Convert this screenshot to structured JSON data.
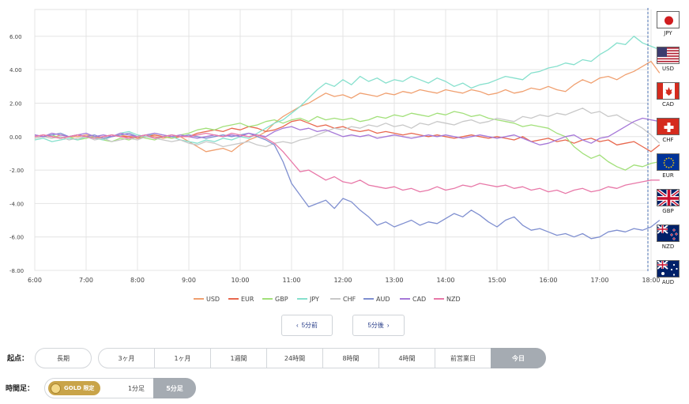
{
  "chart_data": {
    "type": "line",
    "x": [
      "6:00",
      "6:10",
      "6:20",
      "6:30",
      "6:40",
      "6:50",
      "7:00",
      "7:10",
      "7:20",
      "7:30",
      "7:40",
      "7:50",
      "8:00",
      "8:10",
      "8:20",
      "8:30",
      "8:40",
      "8:50",
      "9:00",
      "9:10",
      "9:20",
      "9:30",
      "9:40",
      "9:50",
      "10:00",
      "10:10",
      "10:20",
      "10:30",
      "10:40",
      "10:50",
      "11:00",
      "11:10",
      "11:20",
      "11:30",
      "11:40",
      "11:50",
      "12:00",
      "12:10",
      "12:20",
      "12:30",
      "12:40",
      "12:50",
      "13:00",
      "13:10",
      "13:20",
      "13:30",
      "13:40",
      "13:50",
      "14:00",
      "14:10",
      "14:20",
      "14:30",
      "14:40",
      "14:50",
      "15:00",
      "15:10",
      "15:20",
      "15:30",
      "15:40",
      "15:50",
      "16:00",
      "16:10",
      "16:20",
      "16:30",
      "16:40",
      "16:50",
      "17:00",
      "17:10",
      "17:20",
      "17:30",
      "17:40",
      "17:50",
      "18:00",
      "18:10"
    ],
    "xticks": [
      "6:00",
      "7:00",
      "8:00",
      "9:00",
      "10:00",
      "11:00",
      "12:00",
      "13:00",
      "14:00",
      "15:00",
      "16:00",
      "17:00",
      "18:00"
    ],
    "yticks": [
      "6.00",
      "4.00",
      "2.00",
      "0.00",
      "-2.00",
      "-4.00",
      "-6.00",
      "-8.00"
    ],
    "ylim": [
      -8,
      7.6
    ],
    "series": [
      {
        "name": "USD",
        "color": "#f0a070",
        "values": [
          0.1,
          0.0,
          -0.1,
          0.1,
          0.0,
          0.0,
          0.1,
          0.0,
          -0.1,
          0.0,
          0.1,
          0.0,
          0.0,
          0.1,
          0.0,
          -0.1,
          0.0,
          0.0,
          -0.3,
          -0.6,
          -0.9,
          -0.8,
          -0.7,
          -0.9,
          -0.5,
          -0.2,
          0.0,
          0.3,
          0.8,
          1.2,
          1.5,
          1.8,
          2.0,
          2.3,
          2.6,
          2.4,
          2.5,
          2.3,
          2.6,
          2.5,
          2.4,
          2.6,
          2.5,
          2.7,
          2.6,
          2.8,
          2.7,
          2.6,
          2.8,
          2.7,
          2.6,
          2.8,
          2.7,
          2.5,
          2.6,
          2.8,
          2.6,
          2.7,
          2.9,
          2.8,
          3.0,
          2.8,
          2.7,
          3.1,
          3.4,
          3.2,
          3.5,
          3.6,
          3.4,
          3.7,
          3.9,
          4.2,
          4.5,
          3.8
        ]
      },
      {
        "name": "EUR",
        "color": "#e8684e",
        "values": [
          0.0,
          0.1,
          0.0,
          -0.1,
          0.0,
          0.1,
          0.0,
          -0.1,
          0.0,
          0.1,
          0.0,
          0.0,
          -0.1,
          0.0,
          0.1,
          0.0,
          -0.1,
          0.0,
          0.0,
          0.2,
          0.3,
          0.4,
          0.3,
          0.5,
          0.4,
          0.6,
          0.5,
          0.3,
          0.4,
          0.6,
          0.9,
          1.0,
          0.8,
          0.6,
          0.7,
          0.5,
          0.6,
          0.4,
          0.3,
          0.4,
          0.2,
          0.3,
          0.2,
          0.1,
          0.2,
          0.1,
          0.0,
          0.1,
          0.0,
          -0.1,
          0.0,
          0.1,
          0.0,
          -0.1,
          0.0,
          -0.1,
          -0.2,
          0.0,
          -0.3,
          -0.2,
          -0.1,
          -0.3,
          -0.2,
          -0.4,
          -0.2,
          -0.1,
          -0.3,
          -0.2,
          -0.5,
          -0.4,
          -0.3,
          -0.6,
          -0.9,
          -0.5
        ]
      },
      {
        "name": "GBP",
        "color": "#a2e07a",
        "values": [
          -0.1,
          0.0,
          0.1,
          -0.1,
          0.0,
          -0.2,
          -0.1,
          0.0,
          -0.2,
          -0.3,
          -0.1,
          -0.2,
          0.0,
          -0.1,
          -0.2,
          0.0,
          -0.1,
          0.1,
          0.2,
          0.4,
          0.5,
          0.4,
          0.6,
          0.7,
          0.8,
          0.6,
          0.7,
          0.9,
          1.0,
          0.8,
          1.0,
          1.1,
          0.9,
          1.2,
          1.0,
          1.1,
          1.0,
          1.1,
          0.9,
          1.0,
          1.2,
          1.1,
          1.3,
          1.2,
          1.4,
          1.3,
          1.2,
          1.4,
          1.3,
          1.5,
          1.4,
          1.2,
          1.3,
          1.1,
          1.0,
          0.9,
          0.8,
          0.6,
          0.7,
          0.6,
          0.5,
          0.2,
          0.0,
          -0.6,
          -1.0,
          -1.3,
          -1.1,
          -1.5,
          -1.8,
          -2.0,
          -1.7,
          -1.8,
          -1.6,
          -1.5
        ]
      },
      {
        "name": "JPY",
        "color": "#86e0cd",
        "values": [
          -0.2,
          -0.1,
          -0.3,
          -0.2,
          -0.1,
          -0.2,
          0.0,
          -0.1,
          -0.2,
          0.0,
          0.2,
          0.3,
          0.1,
          0.0,
          0.2,
          0.1,
          0.0,
          -0.2,
          -0.3,
          -0.4,
          -0.2,
          -0.3,
          -0.1,
          -0.2,
          0.0,
          -0.1,
          0.2,
          0.5,
          0.8,
          1.0,
          1.4,
          1.8,
          2.3,
          2.8,
          3.2,
          3.0,
          3.4,
          3.1,
          3.6,
          3.3,
          3.5,
          3.2,
          3.4,
          3.3,
          3.6,
          3.4,
          3.2,
          3.5,
          3.3,
          3.0,
          3.2,
          2.9,
          3.1,
          3.2,
          3.4,
          3.6,
          3.5,
          3.4,
          3.8,
          3.9,
          4.1,
          4.2,
          4.4,
          4.3,
          4.6,
          4.5,
          4.9,
          5.2,
          5.6,
          5.5,
          6.0,
          5.6,
          5.4,
          5.2
        ]
      },
      {
        "name": "CHF",
        "color": "#c8c8c8",
        "values": [
          -0.1,
          0.0,
          -0.1,
          0.0,
          -0.2,
          -0.1,
          0.0,
          -0.2,
          -0.1,
          -0.3,
          -0.2,
          -0.1,
          -0.2,
          0.0,
          -0.1,
          -0.2,
          -0.3,
          -0.2,
          -0.4,
          -0.5,
          -0.3,
          -0.4,
          -0.6,
          -0.5,
          -0.4,
          -0.3,
          -0.5,
          -0.6,
          -0.4,
          -0.3,
          -0.4,
          -0.2,
          -0.1,
          0.1,
          0.3,
          0.5,
          0.4,
          0.6,
          0.5,
          0.7,
          0.6,
          0.8,
          0.6,
          0.7,
          0.5,
          0.8,
          0.7,
          0.9,
          0.8,
          0.7,
          0.9,
          1.0,
          0.8,
          0.9,
          1.1,
          1.0,
          0.9,
          1.2,
          1.1,
          1.3,
          1.2,
          1.4,
          1.3,
          1.5,
          1.7,
          1.4,
          1.5,
          1.2,
          1.3,
          1.0,
          0.8,
          0.5,
          0.1,
          -0.4
        ]
      },
      {
        "name": "AUD",
        "color": "#7f8fd0",
        "values": [
          0.1,
          0.0,
          0.1,
          0.2,
          0.0,
          0.1,
          0.0,
          0.1,
          -0.1,
          0.0,
          0.1,
          0.2,
          0.0,
          0.1,
          -0.1,
          0.0,
          0.1,
          0.0,
          0.1,
          0.0,
          -0.1,
          0.0,
          0.1,
          0.0,
          0.1,
          0.2,
          0.0,
          -0.2,
          -0.5,
          -1.5,
          -2.8,
          -3.5,
          -4.2,
          -4.0,
          -3.8,
          -4.3,
          -3.7,
          -3.9,
          -4.4,
          -4.8,
          -5.3,
          -5.1,
          -5.4,
          -5.2,
          -5.0,
          -5.3,
          -5.1,
          -5.2,
          -4.9,
          -4.6,
          -4.8,
          -4.4,
          -4.7,
          -5.1,
          -5.4,
          -5.0,
          -4.8,
          -5.3,
          -5.6,
          -5.5,
          -5.7,
          -5.9,
          -5.8,
          -6.0,
          -5.8,
          -6.1,
          -6.0,
          -5.7,
          -5.6,
          -5.7,
          -5.5,
          -5.6,
          -5.4,
          -5.0
        ]
      },
      {
        "name": "CAD",
        "color": "#a678d8",
        "values": [
          0.1,
          0.0,
          0.2,
          0.1,
          0.0,
          0.1,
          0.2,
          0.0,
          0.1,
          0.0,
          0.2,
          0.1,
          0.0,
          0.1,
          0.2,
          0.1,
          0.0,
          0.1,
          0.0,
          -0.1,
          0.0,
          0.1,
          0.0,
          0.1,
          0.0,
          0.2,
          0.1,
          0.0,
          0.3,
          0.5,
          0.6,
          0.4,
          0.5,
          0.3,
          0.4,
          0.2,
          0.0,
          0.1,
          0.0,
          0.1,
          -0.1,
          0.0,
          0.1,
          0.0,
          -0.1,
          0.0,
          0.1,
          0.0,
          0.1,
          0.0,
          -0.1,
          0.0,
          0.1,
          0.0,
          -0.1,
          0.0,
          0.1,
          -0.1,
          -0.3,
          -0.5,
          -0.4,
          -0.2,
          0.0,
          0.1,
          -0.2,
          -0.4,
          -0.1,
          0.0,
          0.3,
          0.6,
          0.9,
          1.1,
          1.0,
          0.9
        ]
      },
      {
        "name": "NZD",
        "color": "#e878a8",
        "values": [
          0.0,
          0.1,
          0.0,
          -0.1,
          0.0,
          0.1,
          0.0,
          -0.1,
          0.0,
          0.1,
          0.0,
          -0.1,
          0.0,
          0.1,
          -0.1,
          0.0,
          0.1,
          0.0,
          0.0,
          0.1,
          0.2,
          0.1,
          0.0,
          0.2,
          0.1,
          0.0,
          0.1,
          -0.1,
          -0.4,
          -0.9,
          -1.5,
          -2.1,
          -2.0,
          -2.3,
          -2.6,
          -2.4,
          -2.7,
          -2.8,
          -2.6,
          -2.9,
          -3.0,
          -3.1,
          -3.0,
          -3.2,
          -3.1,
          -3.3,
          -3.2,
          -3.0,
          -3.2,
          -3.1,
          -2.9,
          -3.0,
          -2.8,
          -2.9,
          -3.0,
          -2.9,
          -3.1,
          -3.0,
          -3.2,
          -3.1,
          -3.3,
          -3.2,
          -3.4,
          -3.2,
          -3.1,
          -3.3,
          -3.2,
          -3.0,
          -3.1,
          -2.9,
          -2.8,
          -2.7,
          -2.6,
          -2.6
        ]
      }
    ]
  },
  "flags": [
    {
      "code": "JPY",
      "label": "JPY"
    },
    {
      "code": "USD",
      "label": "USD"
    },
    {
      "code": "CAD",
      "label": "CAD"
    },
    {
      "code": "CHF",
      "label": "CHF"
    },
    {
      "code": "EUR",
      "label": "EUR"
    },
    {
      "code": "GBP",
      "label": "GBP"
    },
    {
      "code": "NZD",
      "label": "NZD"
    },
    {
      "code": "AUD",
      "label": "AUD"
    }
  ],
  "nav": {
    "prev_label": "5分前",
    "next_label": "5分後",
    "prev_icon": "chevron-left-icon",
    "next_icon": "chevron-right-icon"
  },
  "start_point": {
    "label": "起点：",
    "long_label": "長期",
    "options": [
      "3ヶ月",
      "1ヶ月",
      "1週間",
      "24時間",
      "8時間",
      "4時間",
      "前営業日",
      "今日"
    ],
    "selected": "今日"
  },
  "timeframe": {
    "label": "時間足：",
    "gold_label": "GOLD 限定",
    "options": [
      "1分足",
      "5分足"
    ],
    "selected": "5分足"
  }
}
